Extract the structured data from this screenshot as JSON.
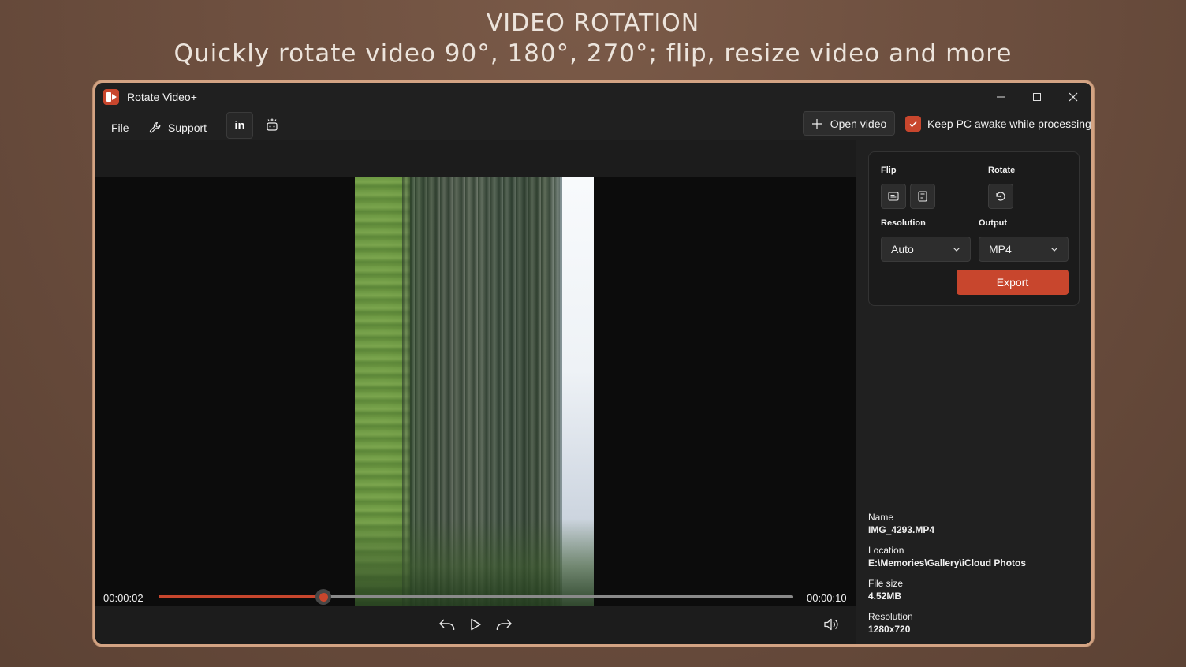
{
  "promo": {
    "title": "VIDEO ROTATION",
    "subtitle": "Quickly rotate video 90°, 180°, 270°; flip, resize video and more"
  },
  "window": {
    "title": "Rotate Video+",
    "controls": {
      "minimize": "—",
      "maximize": "☐",
      "close": "✕"
    }
  },
  "menu": {
    "file": "File",
    "support": "Support",
    "linkedin": "in",
    "open_video": "Open video",
    "keep_awake": "Keep PC awake while processing",
    "keep_awake_checked": true
  },
  "player": {
    "current_time": "00:00:02",
    "total_time": "00:00:10",
    "progress": 0.26
  },
  "panel": {
    "flip_label": "Flip",
    "rotate_label": "Rotate",
    "resolution_label": "Resolution",
    "output_label": "Output",
    "resolution_value": "Auto",
    "output_value": "MP4",
    "export_label": "Export"
  },
  "file_info": {
    "name_label": "Name",
    "name_value": "IMG_4293.MP4",
    "location_label": "Location",
    "location_value": "E:\\Memories\\Gallery\\iCloud Photos",
    "size_label": "File size",
    "size_value": "4.52MB",
    "resolution_label": "Resolution",
    "resolution_value": "1280x720"
  },
  "colors": {
    "accent": "#c8462d",
    "window_border": "#d3a383",
    "window_bg": "#202020"
  }
}
